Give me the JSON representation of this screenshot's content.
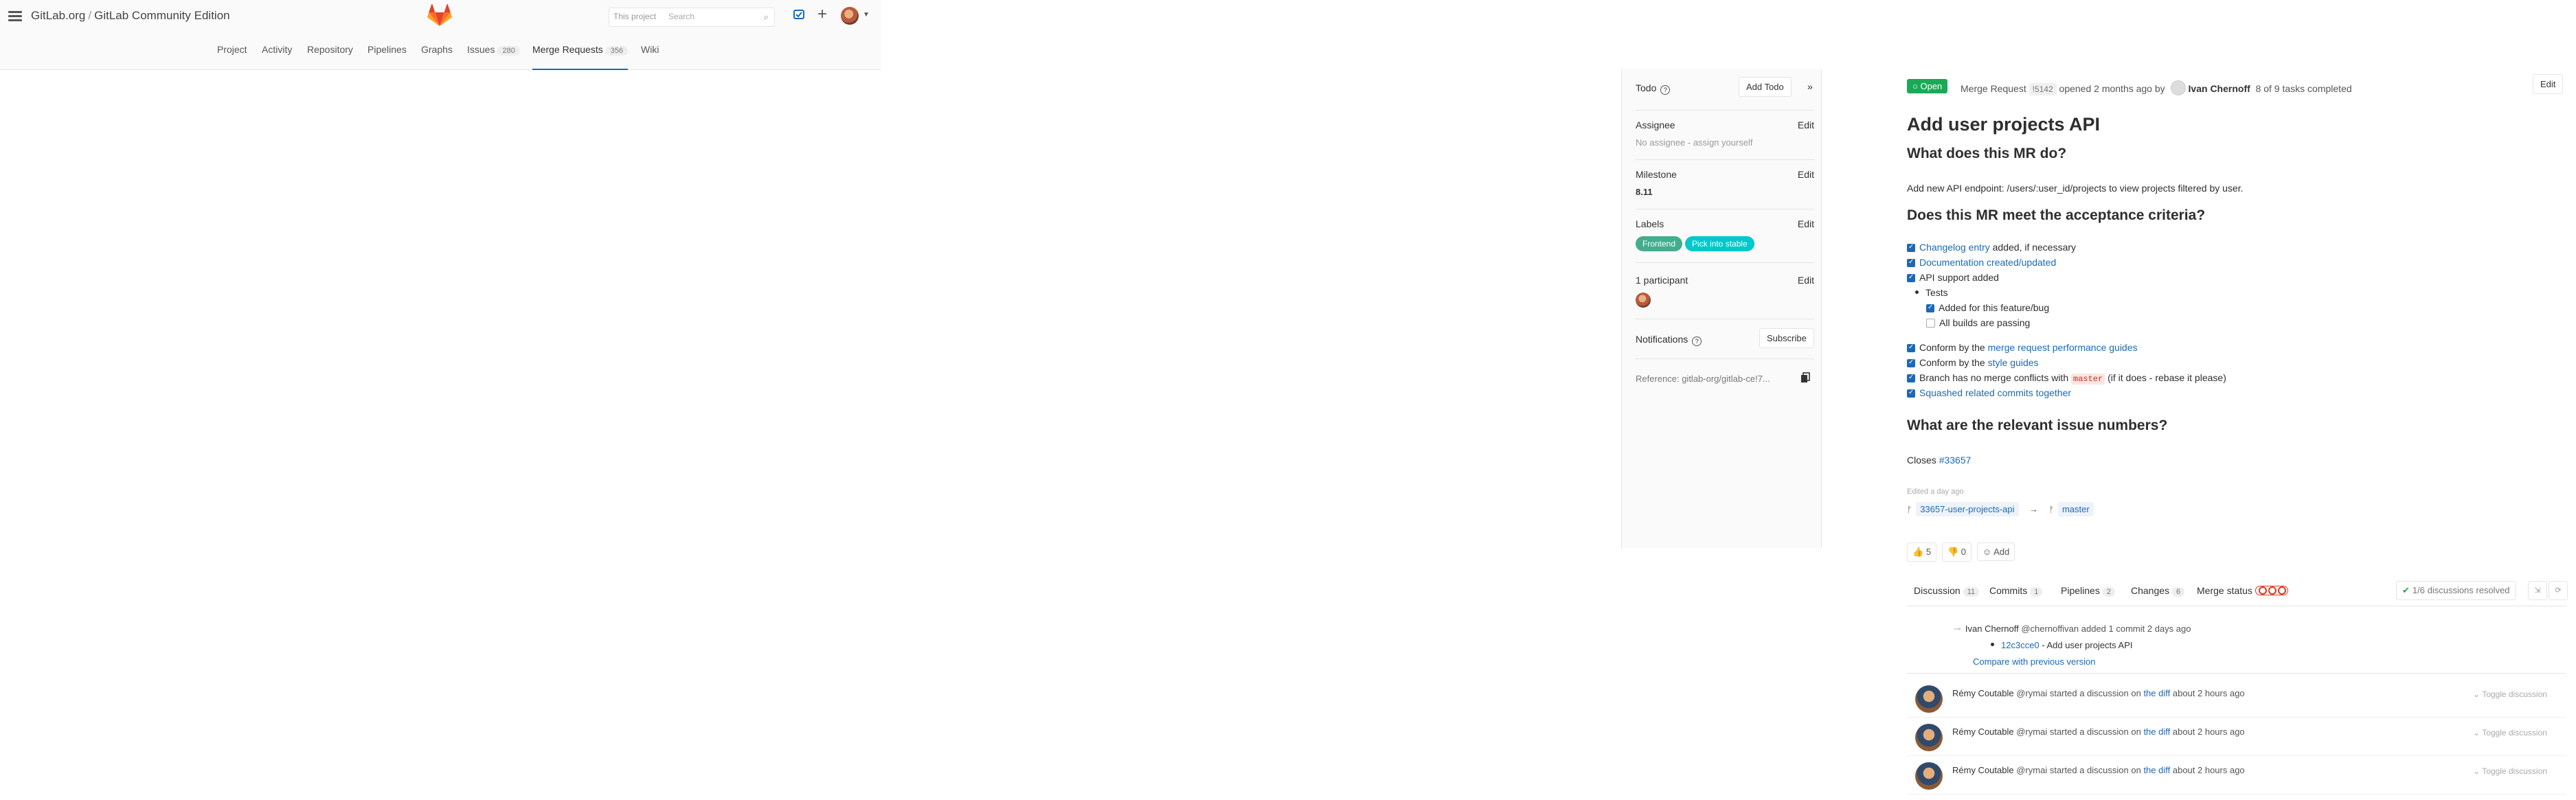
{
  "header": {
    "group": "GitLab.org",
    "separator": "/",
    "project": "GitLab Community Edition",
    "search_scope": "This project",
    "search_placeholder": "Search"
  },
  "nav": {
    "items": [
      {
        "label": "Project"
      },
      {
        "label": "Activity"
      },
      {
        "label": "Repository"
      },
      {
        "label": "Pipelines"
      },
      {
        "label": "Graphs"
      },
      {
        "label": "Issues",
        "count": "280"
      },
      {
        "label": "Merge Requests",
        "count": "356",
        "active": true
      },
      {
        "label": "Wiki"
      }
    ]
  },
  "sidebar": {
    "todo_label": "Todo",
    "add_todo": "Add Todo",
    "collapse": "»",
    "assignee_label": "Assignee",
    "assignee_value": "No assignee - assign yourself",
    "milestone_label": "Milestone",
    "milestone_value": "8.11",
    "labels_label": "Labels",
    "labels": [
      {
        "name": "Frontend",
        "color": "#44ad8e"
      },
      {
        "name": "Pick into stable",
        "color": "#00c8ca"
      }
    ],
    "participants_label": "1 participant",
    "notifications_label": "Notifications",
    "subscribe": "Subscribe",
    "reference": "Reference: gitlab-org/gitlab-ce!7...",
    "edit": "Edit"
  },
  "mr": {
    "status": "Open",
    "kind": "Merge Request",
    "ref": "!5142",
    "opened": "opened 2 months ago by",
    "author": "Ivan Chernoff",
    "tasks": "8 of 9 tasks completed",
    "edit": "Edit",
    "title": "Add user projects API",
    "h_what": "What does this MR do?",
    "p_what": "Add new API endpoint: /users/:user_id/projects to view projects filtered by user.",
    "h_accept": "Does this MR meet the acceptance criteria?",
    "tasks_list": {
      "changelog_link": "Changelog entry",
      "changelog_rest": " added, if necessary",
      "docs_link": "Documentation created/updated",
      "api": "API support added",
      "tests": "Tests",
      "tests_feature": "Added for this feature/bug",
      "tests_builds": "All builds are passing",
      "conform_prefix": "Conform by the ",
      "conform_perf_link": "merge request performance guides",
      "conform_style_link": "style guides",
      "conflicts_prefix": "Branch has no merge conflicts with ",
      "conflicts_code": "master",
      "conflicts_suffix": " (if it does - rebase it please)",
      "squash_link": "Squashed related commits together"
    },
    "h_issues": "What are the relevant issue numbers?",
    "closes_prefix": "Closes ",
    "closes_link": "#33657",
    "edited": "Edited a day ago",
    "source_branch": "33657-user-projects-api",
    "arrow": "→",
    "target_branch": "master",
    "awards": {
      "thumbs_up": "5",
      "thumbs_down": "0",
      "add": "Add"
    }
  },
  "tabs": {
    "discussion": "Discussion",
    "discussion_count": "11",
    "commits": "Commits",
    "commits_count": "1",
    "pipelines": "Pipelines",
    "pipelines_count": "2",
    "changes": "Changes",
    "changes_count": "6",
    "merge_status": "Merge status",
    "resolved": "1/6 discussions resolved"
  },
  "commit_note": {
    "author": "Ivan Chernoff",
    "handle": "@chernoffivan",
    "action": "added 1 commit 2 days ago",
    "sha": "12c3cce0",
    "message": " - Add user projects API",
    "compare": "Compare with previous version"
  },
  "discussions": [
    {
      "author": "Rémy Coutable",
      "handle": "@rymai",
      "action": "started a discussion on",
      "link": "the diff",
      "time": "about 2 hours ago",
      "toggle": "Toggle discussion"
    },
    {
      "author": "Rémy Coutable",
      "handle": "@rymai",
      "action": "started a discussion on",
      "link": "the diff",
      "time": "about 2 hours ago",
      "toggle": "Toggle discussion"
    },
    {
      "author": "Rémy Coutable",
      "handle": "@rymai",
      "action": "started a discussion on",
      "link": "the diff",
      "time": "about 2 hours ago",
      "toggle": "Toggle discussion"
    }
  ],
  "colors": {
    "accent": "#1b69b6",
    "open": "#1aaa55",
    "brand": "#e24329"
  }
}
